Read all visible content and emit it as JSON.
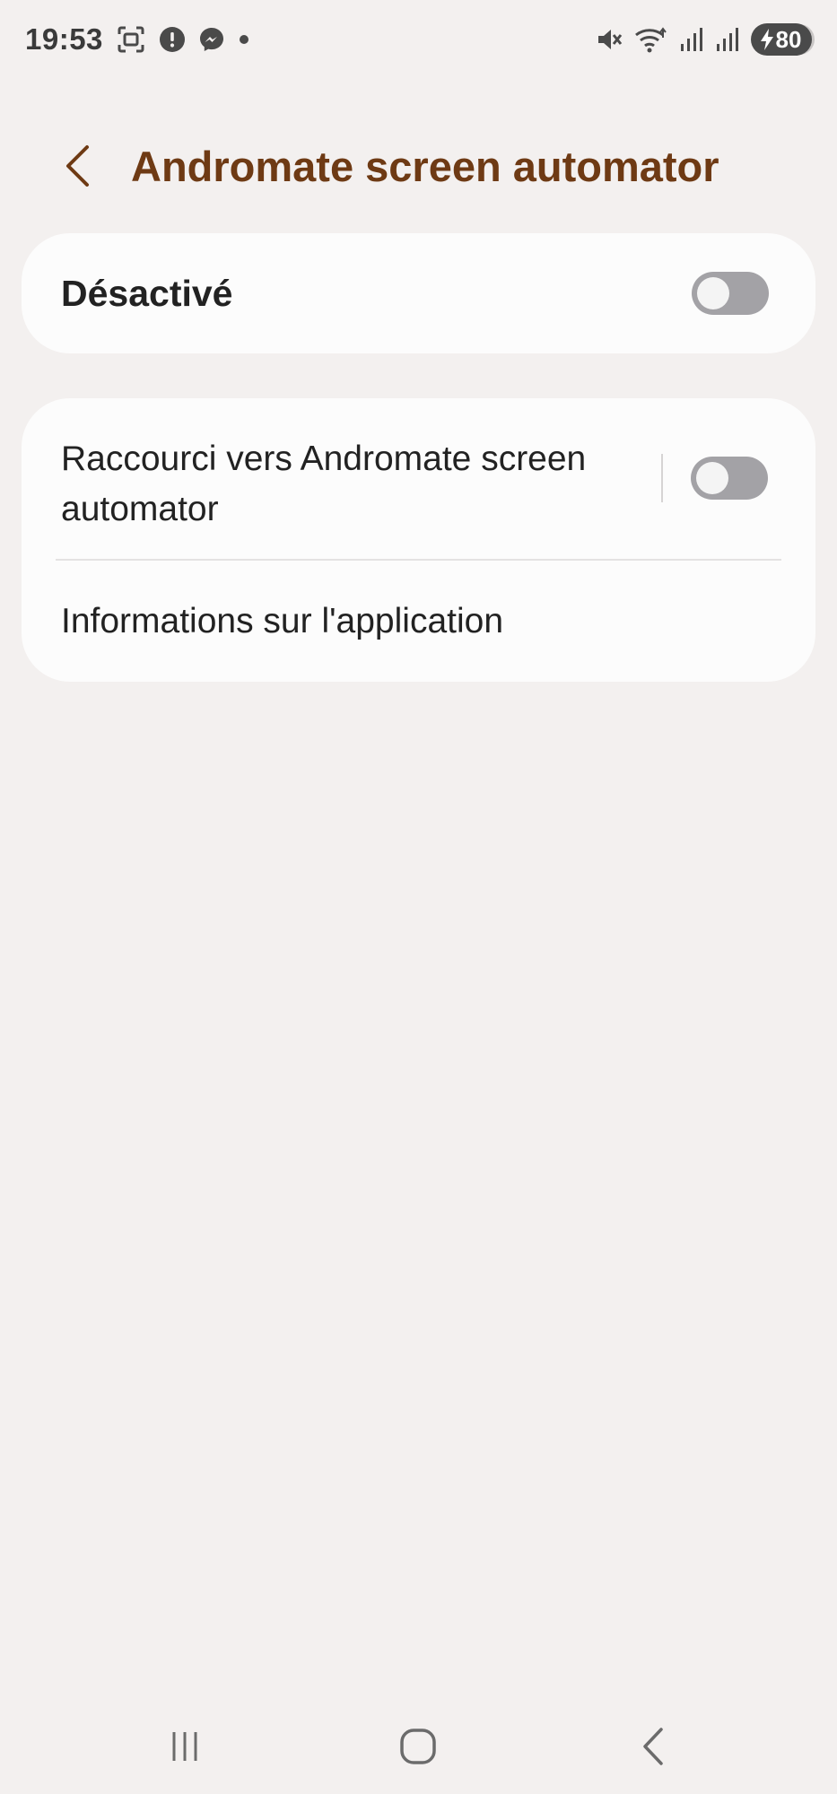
{
  "status_bar": {
    "time": "19:53",
    "left_icons": [
      "screenshot-icon",
      "alert-icon",
      "messenger-icon",
      "dot-icon"
    ],
    "right_icons": [
      "mute-icon",
      "wifi-icon",
      "signal-icon",
      "signal-icon"
    ],
    "battery_level": "80",
    "charging": true
  },
  "header": {
    "title": "Andromate screen automator",
    "title_color": "#6e3a14"
  },
  "master_switch": {
    "label": "Désactivé",
    "on": false
  },
  "options": {
    "shortcut": {
      "label": "Raccourci vers Andromate screen automator",
      "on": false
    },
    "app_info": {
      "label": "Informations sur l'application"
    }
  },
  "nav_bar": {
    "buttons": [
      "recents-icon",
      "home-icon",
      "back-icon"
    ]
  },
  "colors": {
    "background": "#f3f0ef",
    "card": "#fcfcfc",
    "accent": "#6e3a14",
    "toggle_off": "#a3a2a6"
  }
}
